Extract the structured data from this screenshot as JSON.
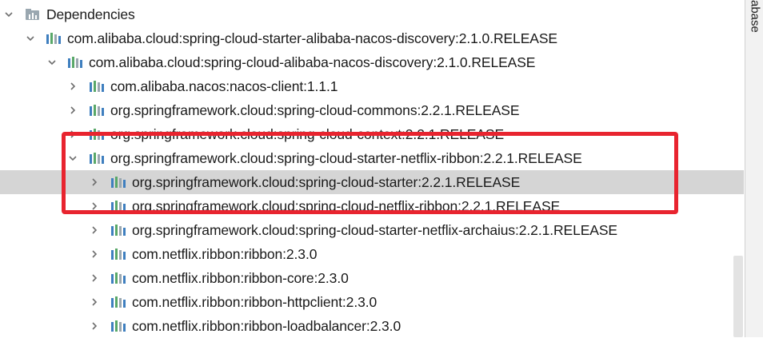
{
  "tree": {
    "rows": [
      {
        "label": "Dependencies",
        "expanded": true,
        "icon": "folder-chart-icon"
      },
      {
        "label": "com.alibaba.cloud:spring-cloud-starter-alibaba-nacos-discovery:2.1.0.RELEASE",
        "expanded": true,
        "icon": "library-icon"
      },
      {
        "label": "com.alibaba.cloud:spring-cloud-alibaba-nacos-discovery:2.1.0.RELEASE",
        "expanded": true,
        "icon": "library-icon"
      },
      {
        "label": "com.alibaba.nacos:nacos-client:1.1.1",
        "expanded": false,
        "icon": "library-icon"
      },
      {
        "label": "org.springframework.cloud:spring-cloud-commons:2.2.1.RELEASE",
        "expanded": false,
        "icon": "library-icon"
      },
      {
        "label": "org.springframework.cloud:spring-cloud-context:2.2.1.RELEASE",
        "expanded": false,
        "icon": "library-icon"
      },
      {
        "label": "org.springframework.cloud:spring-cloud-starter-netflix-ribbon:2.2.1.RELEASE",
        "expanded": true,
        "icon": "library-icon"
      },
      {
        "label": "org.springframework.cloud:spring-cloud-starter:2.2.1.RELEASE",
        "expanded": false,
        "icon": "library-icon",
        "selected": true
      },
      {
        "label": "org.springframework.cloud:spring-cloud-netflix-ribbon:2.2.1.RELEASE",
        "expanded": false,
        "icon": "library-icon"
      },
      {
        "label": "org.springframework.cloud:spring-cloud-starter-netflix-archaius:2.2.1.RELEASE",
        "expanded": false,
        "icon": "library-icon"
      },
      {
        "label": "com.netflix.ribbon:ribbon:2.3.0",
        "expanded": false,
        "icon": "library-icon"
      },
      {
        "label": "com.netflix.ribbon:ribbon-core:2.3.0",
        "expanded": false,
        "icon": "library-icon"
      },
      {
        "label": "com.netflix.ribbon:ribbon-httpclient:2.3.0",
        "expanded": false,
        "icon": "library-icon"
      },
      {
        "label": "com.netflix.ribbon:ribbon-loadbalancer:2.3.0",
        "expanded": false,
        "icon": "library-icon"
      }
    ]
  },
  "side_panel": {
    "tab_label": "abase"
  },
  "colors": {
    "selection": "#d5d5d5",
    "highlight_border": "#e8242f",
    "icon_blue": "#3f7fbf",
    "icon_green": "#59a869",
    "icon_gray": "#9aa7b0"
  }
}
